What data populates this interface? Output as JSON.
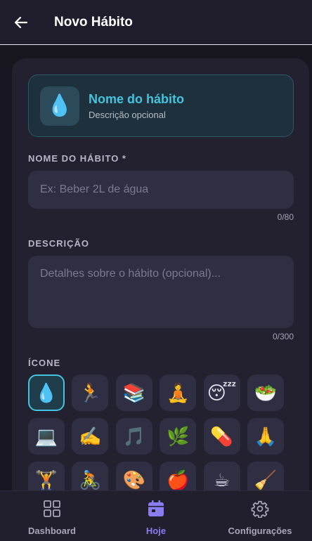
{
  "header": {
    "title": "Novo Hábito",
    "back_icon": "arrow-left-icon"
  },
  "preview": {
    "icon": "💧",
    "name": "Nome do hábito",
    "description": "Descrição opcional"
  },
  "form": {
    "name_label": "NOME DO HÁBITO *",
    "name_value": "",
    "name_placeholder": "Ex: Beber 2L de água",
    "name_counter": "0/80",
    "description_label": "DESCRIÇÃO",
    "description_value": "",
    "description_placeholder": "Detalhes sobre o hábito (opcional)...",
    "description_counter": "0/300",
    "icon_label": "ÍCONE"
  },
  "icons": {
    "selected": "💧",
    "options": [
      "💧",
      "🏃",
      "📚",
      "🧘",
      "😴",
      "🥗",
      "💻",
      "✍️",
      "🎵",
      "🌿",
      "💊",
      "🙏",
      "🏋️",
      "🚴",
      "🎨",
      "🍎",
      "☕",
      "🧹"
    ]
  },
  "bottom_nav": {
    "items": [
      {
        "label": "Dashboard",
        "icon": "grid-icon",
        "active": false
      },
      {
        "label": "Hoje",
        "icon": "calendar-icon",
        "active": true
      },
      {
        "label": "Configurações",
        "icon": "gear-icon",
        "active": false
      }
    ]
  },
  "colors": {
    "accent": "#46c3df",
    "nav_active": "#8a7cf3",
    "background": "#17161f",
    "card": "#23212f"
  }
}
